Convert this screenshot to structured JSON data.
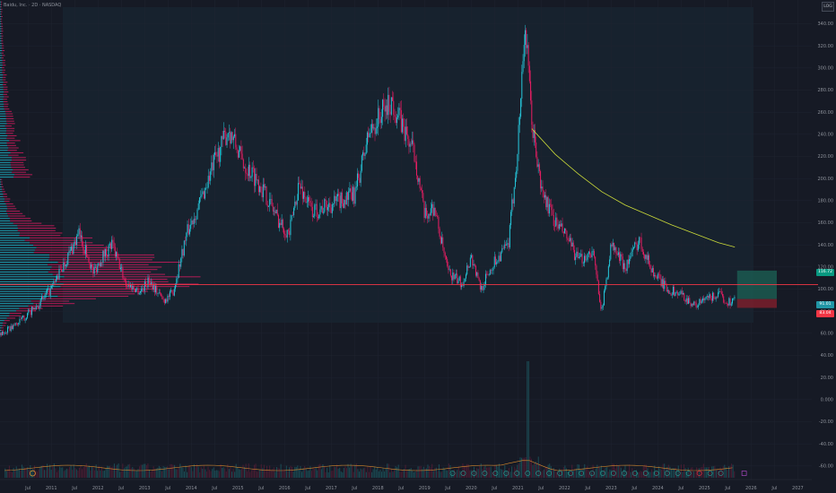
{
  "header": {
    "title": "Baidu, Inc. · 2D · NASDAQ"
  },
  "scale_button": "LOG",
  "badges": {
    "upper": "116.72",
    "mid": "91.01",
    "lower": "83.04"
  },
  "colors": {
    "background": "#161a25",
    "candle_up": "#26c6da",
    "candle_down": "#e91e63",
    "ma_line": "#cddc39",
    "hline": "#f23645",
    "profile_up": "#1fb5c9",
    "profile_down": "#d81b60",
    "target_box": "#1b5e52",
    "stop_box": "#7a1f2b"
  },
  "chart_data": {
    "type": "candlestick",
    "ylim": [
      -65,
      355
    ],
    "y_ticks": [
      "340.00",
      "320.00",
      "300.00",
      "280.00",
      "260.00",
      "240.00",
      "220.00",
      "200.00",
      "180.00",
      "160.00",
      "140.00",
      "120.00",
      "100.00",
      "80.00",
      "60.00",
      "40.00",
      "20.00",
      "0.000",
      "-20.00",
      "-40.00",
      "-60.00"
    ],
    "y_tick_values": [
      340,
      320,
      300,
      280,
      260,
      240,
      220,
      200,
      180,
      160,
      140,
      120,
      100,
      80,
      60,
      40,
      20,
      0,
      -20,
      -40,
      -60
    ],
    "x_labels": [
      "Jul",
      "2011",
      "Jul",
      "2012",
      "Jul",
      "2013",
      "Jul",
      "2014",
      "Jul",
      "2015",
      "Jul",
      "2016",
      "Jul",
      "2017",
      "Jul",
      "2018",
      "Jul",
      "2019",
      "Jul",
      "2020",
      "Jul",
      "2021",
      "Jul",
      "2022",
      "Jul",
      "2023",
      "Jul",
      "2024",
      "Jul",
      "2025",
      "Jul",
      "2026",
      "Jul",
      "2027"
    ],
    "x_years": [
      2010.5,
      2011,
      2011.5,
      2012,
      2012.5,
      2013,
      2013.5,
      2014,
      2014.5,
      2015,
      2015.5,
      2016,
      2016.5,
      2017,
      2017.5,
      2018,
      2018.5,
      2019,
      2019.5,
      2020,
      2020.5,
      2021,
      2021.5,
      2022,
      2022.5,
      2023,
      2023.5,
      2024,
      2024.5,
      2025,
      2025.5,
      2026,
      2026.5,
      2027
    ],
    "price_path": [
      {
        "x": 2009.9,
        "y": 58
      },
      {
        "x": 2010.3,
        "y": 70
      },
      {
        "x": 2010.7,
        "y": 85
      },
      {
        "x": 2011.0,
        "y": 100
      },
      {
        "x": 2011.3,
        "y": 125
      },
      {
        "x": 2011.6,
        "y": 150
      },
      {
        "x": 2011.9,
        "y": 115
      },
      {
        "x": 2012.1,
        "y": 130
      },
      {
        "x": 2012.3,
        "y": 140
      },
      {
        "x": 2012.6,
        "y": 105
      },
      {
        "x": 2012.9,
        "y": 98
      },
      {
        "x": 2013.1,
        "y": 108
      },
      {
        "x": 2013.4,
        "y": 90
      },
      {
        "x": 2013.6,
        "y": 96
      },
      {
        "x": 2013.9,
        "y": 150
      },
      {
        "x": 2014.2,
        "y": 180
      },
      {
        "x": 2014.5,
        "y": 215
      },
      {
        "x": 2014.8,
        "y": 245
      },
      {
        "x": 2015.1,
        "y": 215
      },
      {
        "x": 2015.4,
        "y": 200
      },
      {
        "x": 2015.6,
        "y": 185
      },
      {
        "x": 2015.9,
        "y": 160
      },
      {
        "x": 2016.1,
        "y": 150
      },
      {
        "x": 2016.3,
        "y": 195
      },
      {
        "x": 2016.6,
        "y": 170
      },
      {
        "x": 2016.9,
        "y": 175
      },
      {
        "x": 2017.2,
        "y": 180
      },
      {
        "x": 2017.5,
        "y": 185
      },
      {
        "x": 2017.8,
        "y": 240
      },
      {
        "x": 2018.1,
        "y": 260
      },
      {
        "x": 2018.3,
        "y": 270
      },
      {
        "x": 2018.5,
        "y": 250
      },
      {
        "x": 2018.8,
        "y": 220
      },
      {
        "x": 2019.0,
        "y": 165
      },
      {
        "x": 2019.2,
        "y": 175
      },
      {
        "x": 2019.5,
        "y": 115
      },
      {
        "x": 2019.8,
        "y": 105
      },
      {
        "x": 2020.0,
        "y": 130
      },
      {
        "x": 2020.2,
        "y": 100
      },
      {
        "x": 2020.5,
        "y": 125
      },
      {
        "x": 2020.8,
        "y": 140
      },
      {
        "x": 2021.0,
        "y": 230
      },
      {
        "x": 2021.15,
        "y": 340
      },
      {
        "x": 2021.3,
        "y": 250
      },
      {
        "x": 2021.5,
        "y": 190
      },
      {
        "x": 2021.8,
        "y": 160
      },
      {
        "x": 2022.0,
        "y": 150
      },
      {
        "x": 2022.3,
        "y": 125
      },
      {
        "x": 2022.6,
        "y": 135
      },
      {
        "x": 2022.8,
        "y": 80
      },
      {
        "x": 2023.0,
        "y": 140
      },
      {
        "x": 2023.3,
        "y": 120
      },
      {
        "x": 2023.6,
        "y": 145
      },
      {
        "x": 2023.9,
        "y": 115
      },
      {
        "x": 2024.2,
        "y": 100
      },
      {
        "x": 2024.5,
        "y": 95
      },
      {
        "x": 2024.8,
        "y": 85
      },
      {
        "x": 2025.0,
        "y": 90
      },
      {
        "x": 2025.3,
        "y": 95
      },
      {
        "x": 2025.5,
        "y": 88
      },
      {
        "x": 2025.65,
        "y": 91
      }
    ],
    "ma_path": [
      {
        "x": 2021.3,
        "y": 245
      },
      {
        "x": 2021.8,
        "y": 222
      },
      {
        "x": 2022.3,
        "y": 204
      },
      {
        "x": 2022.8,
        "y": 188
      },
      {
        "x": 2023.3,
        "y": 176
      },
      {
        "x": 2023.8,
        "y": 167
      },
      {
        "x": 2024.3,
        "y": 158
      },
      {
        "x": 2024.8,
        "y": 150
      },
      {
        "x": 2025.3,
        "y": 142
      },
      {
        "x": 2025.65,
        "y": 138
      }
    ],
    "hline_value": 104,
    "target_box": {
      "x0": 2025.7,
      "x1": 2026.55,
      "y0": 91,
      "y1": 116.7
    },
    "stop_box": {
      "x0": 2025.7,
      "x1": 2026.55,
      "y0": 83,
      "y1": 91
    },
    "volume_spike_x": 2021.2
  }
}
